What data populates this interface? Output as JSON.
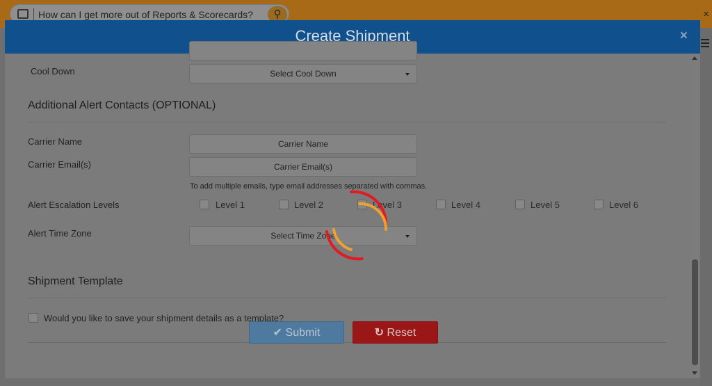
{
  "background": {
    "search_query": "How can I get more out of Reports & Scorecards?",
    "close_glyph": "×",
    "search_glyph": "⚲"
  },
  "modal": {
    "title": "Create Shipment",
    "close_glyph": "×"
  },
  "form": {
    "cool_down": {
      "label": "Cool Down",
      "placeholder": "Select Cool Down"
    },
    "alert_contacts": {
      "heading": "Additional Alert Contacts (OPTIONAL)",
      "carrier_name": {
        "label": "Carrier Name",
        "placeholder": "Carrier Name"
      },
      "carrier_email": {
        "label": "Carrier Email(s)",
        "placeholder": "Carrier Email(s)"
      },
      "email_hint": "To add multiple emails, type email addresses separated with commas.",
      "escalation": {
        "label": "Alert Escalation Levels",
        "levels": [
          "Level 1",
          "Level 2",
          "Level 3",
          "Level 4",
          "Level 5",
          "Level 6"
        ]
      },
      "time_zone": {
        "label": "Alert Time Zone",
        "placeholder": "Select Time Zone"
      }
    },
    "template": {
      "heading": "Shipment Template",
      "save_question": "Would you like to save your shipment details as a template?"
    },
    "buttons": {
      "submit": "Submit",
      "reset": "Reset",
      "submit_icon": "✔",
      "reset_icon": "↻"
    }
  },
  "colors": {
    "header": "#10508c",
    "submit": "#4e7a9f",
    "reset": "#9b1616",
    "spinner_red": "#e01b24",
    "spinner_orange": "#f0a030"
  },
  "icons": {
    "edit": "edit-icon",
    "search": "search-icon",
    "close": "close-icon",
    "menu": "menu-icon",
    "caret": "caret-down-icon",
    "check": "checkmark-icon",
    "refresh": "refresh-icon",
    "spinner": "loading-spinner-icon"
  }
}
